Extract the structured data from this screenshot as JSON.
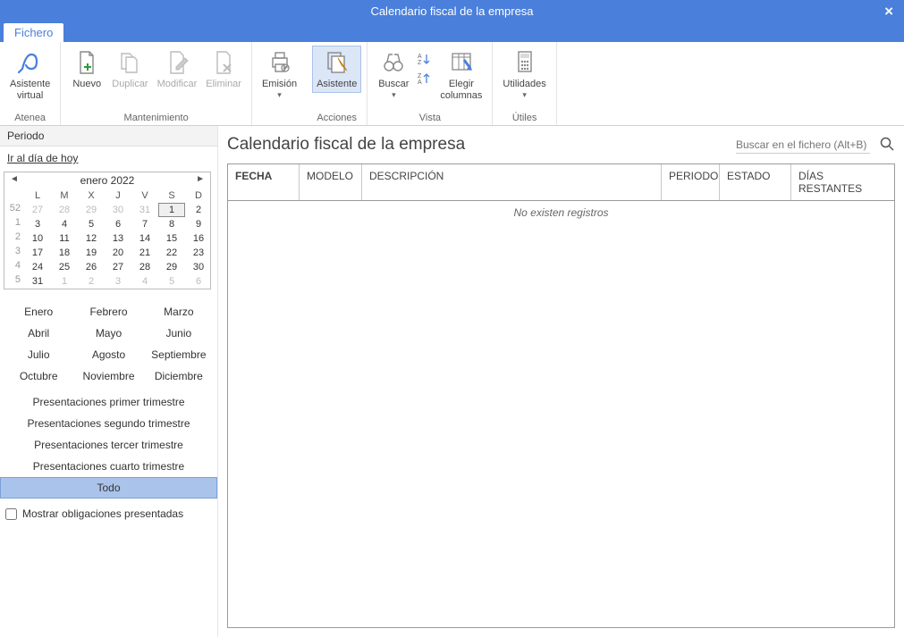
{
  "window": {
    "title": "Calendario fiscal de la empresa",
    "close_label": "×"
  },
  "tabs": {
    "file": "Fichero"
  },
  "ribbon": {
    "atenea": {
      "label": "Asistente\nvirtual",
      "group": "Atenea"
    },
    "nuevo": {
      "label": "Nuevo"
    },
    "duplicar": {
      "label": "Duplicar"
    },
    "modificar": {
      "label": "Modificar"
    },
    "eliminar": {
      "label": "Eliminar"
    },
    "maint_group": "Mantenimiento",
    "emision": {
      "label": "Emisión"
    },
    "asistente": {
      "label": "Asistente"
    },
    "acciones_group": "Acciones",
    "buscar": {
      "label": "Buscar"
    },
    "elegir": {
      "label": "Elegir\ncolumnas"
    },
    "vista_group": "Vista",
    "utilidades": {
      "label": "Utilidades"
    },
    "utiles_group": "Útiles"
  },
  "side": {
    "header": "Periodo",
    "today_link": "Ir al día de hoy",
    "cal_title": "enero  2022",
    "dow": [
      "L",
      "M",
      "X",
      "J",
      "V",
      "S",
      "D"
    ],
    "weeks": [
      "52",
      "1",
      "2",
      "3",
      "4",
      "5"
    ],
    "days": [
      [
        "27",
        "28",
        "29",
        "30",
        "31",
        "1",
        "2"
      ],
      [
        "3",
        "4",
        "5",
        "6",
        "7",
        "8",
        "9"
      ],
      [
        "10",
        "11",
        "12",
        "13",
        "14",
        "15",
        "16"
      ],
      [
        "17",
        "18",
        "19",
        "20",
        "21",
        "22",
        "23"
      ],
      [
        "24",
        "25",
        "26",
        "27",
        "28",
        "29",
        "30"
      ],
      [
        "31",
        "1",
        "2",
        "3",
        "4",
        "5",
        "6"
      ]
    ],
    "months": [
      "Enero",
      "Febrero",
      "Marzo",
      "Abril",
      "Mayo",
      "Junio",
      "Julio",
      "Agosto",
      "Septiembre",
      "Octubre",
      "Noviembre",
      "Diciembre"
    ],
    "presets": [
      "Presentaciones primer trimestre",
      "Presentaciones segundo trimestre",
      "Presentaciones tercer trimestre",
      "Presentaciones cuarto trimestre",
      "Todo"
    ],
    "show_presented": "Mostrar obligaciones presentadas"
  },
  "main": {
    "title": "Calendario fiscal de la empresa",
    "search_placeholder": "Buscar en el fichero (Alt+B)",
    "columns": {
      "fecha": "FECHA",
      "modelo": "MODELO",
      "descripcion": "DESCRIPCIÓN",
      "periodo": "PERIODO",
      "estado": "ESTADO",
      "dias": "DÍAS RESTANTES"
    },
    "empty": "No existen registros"
  }
}
